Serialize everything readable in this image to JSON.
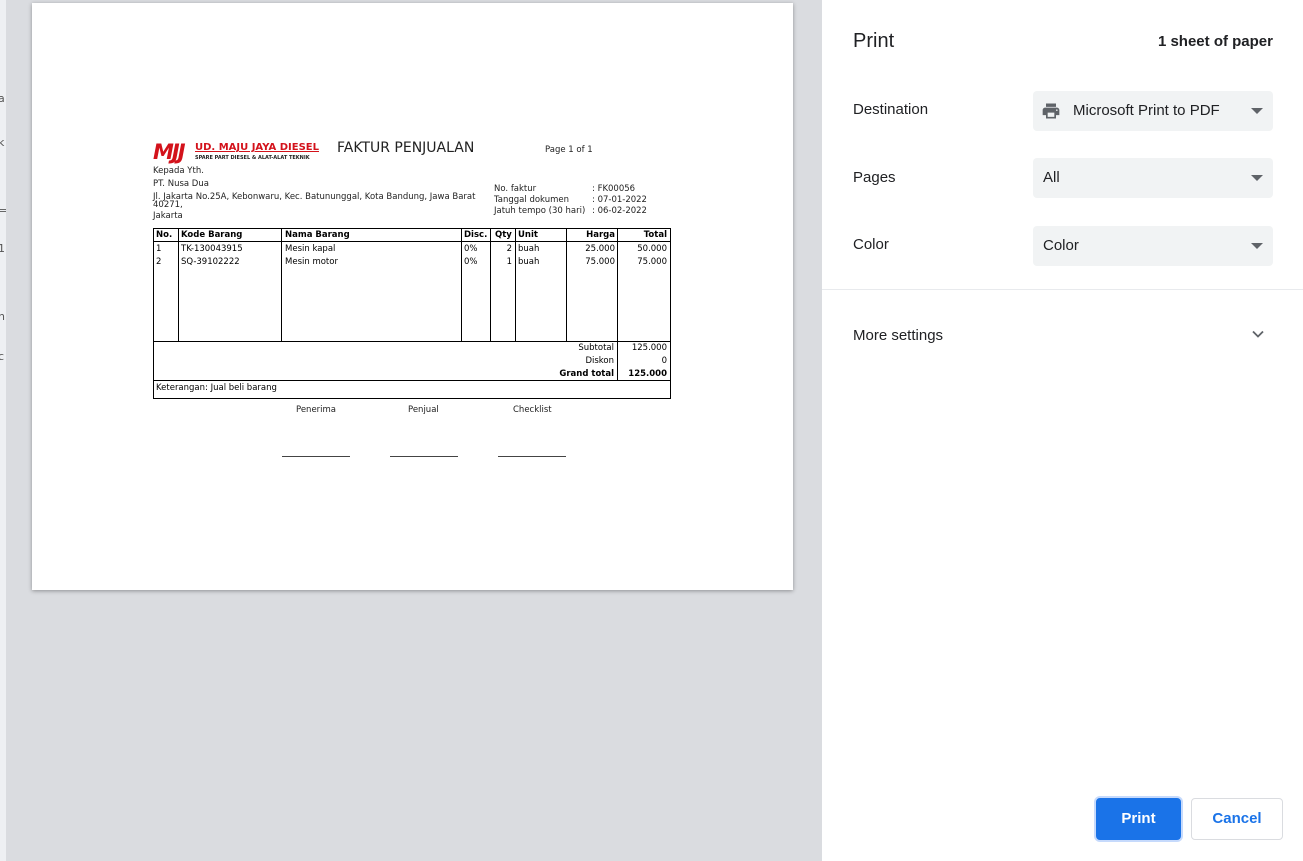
{
  "invoice": {
    "logo_mark": "MJJ",
    "company_name": "UD. MAJU JAYA DIESEL",
    "company_tagline": "SPARE PART DIESEL & ALAT-ALAT TEKNIK",
    "title": "FAKTUR PENJUALAN",
    "page_info": "Page 1 of 1",
    "recipient": {
      "greeting": "Kepada Yth.",
      "name": "PT. Nusa Dua",
      "address_line1": "Jl. Jakarta No.25A, Kebonwaru, Kec. Batununggal, Kota Bandung, Jawa Barat",
      "address_line2": "40271,",
      "city": "Jakarta"
    },
    "meta": [
      {
        "label": "No. faktur",
        "value": ": FK00056"
      },
      {
        "label": "Tanggal dokumen",
        "value": ": 07-01-2022"
      },
      {
        "label": "Jatuh tempo (30 hari)",
        "value": ": 06-02-2022"
      }
    ],
    "columns": [
      "No.",
      "Kode Barang",
      "Nama Barang",
      "Disc.",
      "Qty",
      "Unit",
      "Harga",
      "Total"
    ],
    "rows": [
      {
        "no": "1",
        "code": "TK-130043915",
        "name": "Mesin kapal",
        "disc": "0%",
        "qty": "2",
        "unit": "buah",
        "price": "25.000",
        "total": "50.000"
      },
      {
        "no": "2",
        "code": "SQ-39102222",
        "name": "Mesin motor",
        "disc": "0%",
        "qty": "1",
        "unit": "buah",
        "price": "75.000",
        "total": "75.000"
      }
    ],
    "summary": [
      {
        "label": "Subtotal",
        "value": "125.000"
      },
      {
        "label": "Diskon",
        "value": "0"
      },
      {
        "label": "Grand total",
        "value": "125.000"
      }
    ],
    "note": "Keterangan: Jual beli barang",
    "signatures": [
      "Penerima",
      "Penjual",
      "Checklist"
    ],
    "brand_color": "#d3121b"
  },
  "print_panel": {
    "title": "Print",
    "sheet_count": "1 sheet of paper",
    "destination": {
      "label": "Destination",
      "value": "Microsoft Print to PDF",
      "icon": "printer-icon"
    },
    "pages": {
      "label": "Pages",
      "value": "All"
    },
    "color": {
      "label": "Color",
      "value": "Color"
    },
    "more_settings": {
      "label": "More settings",
      "icon": "chevron-down-icon"
    },
    "print_button": "Print",
    "cancel_button": "Cancel",
    "accent_color": "#1a73e8"
  }
}
